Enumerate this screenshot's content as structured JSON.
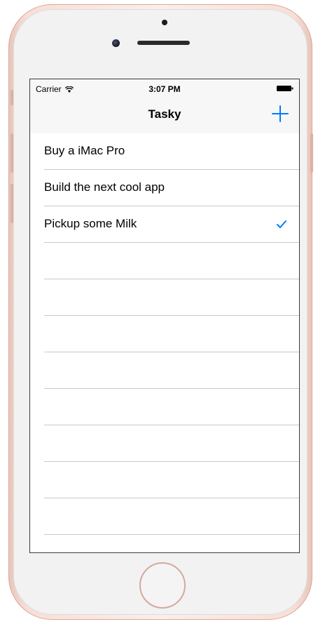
{
  "status_bar": {
    "carrier": "Carrier",
    "time": "3:07 PM",
    "wifi_icon": "wifi-icon",
    "battery_icon": "battery-icon"
  },
  "nav": {
    "title": "Tasky",
    "add_icon": "plus-icon",
    "accent_color": "#007aff"
  },
  "tasks": [
    {
      "label": "Buy a iMac Pro",
      "checked": false
    },
    {
      "label": "Build the next cool app",
      "checked": false
    },
    {
      "label": "Pickup some Milk",
      "checked": true
    }
  ],
  "device": {
    "color": "#f7dfd8"
  }
}
